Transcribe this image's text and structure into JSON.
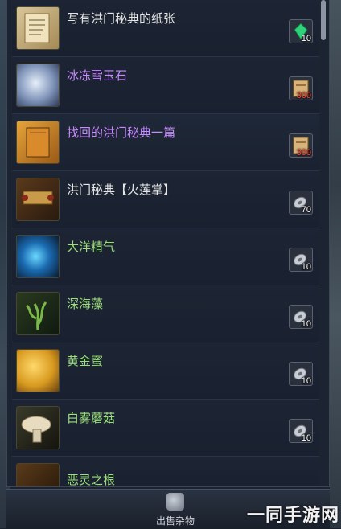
{
  "items": [
    {
      "name": "写有洪门秘典的纸张",
      "color": "#e6e6e6",
      "price": "10",
      "price_color": "#ffffff",
      "currency": "green-gem-icon",
      "icon": "paper-scroll-icon"
    },
    {
      "name": "冰冻雪玉石",
      "color": "#c88aff",
      "price": "300",
      "price_color": "#ff4a3a",
      "currency": "red-seal-icon",
      "icon": "ice-jade-icon"
    },
    {
      "name": "找回的洪门秘典一篇",
      "color": "#c88aff",
      "price": "300",
      "price_color": "#ff4a3a",
      "currency": "red-seal-icon",
      "icon": "secret-book-icon"
    },
    {
      "name": "洪门秘典【火莲掌】",
      "color": "#e6e6e6",
      "price": "70",
      "price_color": "#ffffff",
      "currency": "silver-coin-icon",
      "icon": "fire-lotus-scroll-icon"
    },
    {
      "name": "大洋精气",
      "color": "#9be07a",
      "price": "10",
      "price_color": "#ffffff",
      "currency": "silver-coin-icon",
      "icon": "ocean-essence-icon"
    },
    {
      "name": "深海藻",
      "color": "#9be07a",
      "price": "10",
      "price_color": "#ffffff",
      "currency": "silver-coin-icon",
      "icon": "seaweed-icon"
    },
    {
      "name": "黄金蜜",
      "color": "#9be07a",
      "price": "10",
      "price_color": "#ffffff",
      "currency": "silver-coin-icon",
      "icon": "golden-honey-icon"
    },
    {
      "name": "白雾蘑菇",
      "color": "#9be07a",
      "price": "10",
      "price_color": "#ffffff",
      "currency": "silver-coin-icon",
      "icon": "mushroom-icon"
    },
    {
      "name": "恶灵之根",
      "color": "#9be07a",
      "price": "",
      "price_color": "#ffffff",
      "currency": "",
      "icon": "root-icon"
    }
  ],
  "footer": {
    "sell_label": "出售杂物"
  },
  "watermark": "一同手游网"
}
